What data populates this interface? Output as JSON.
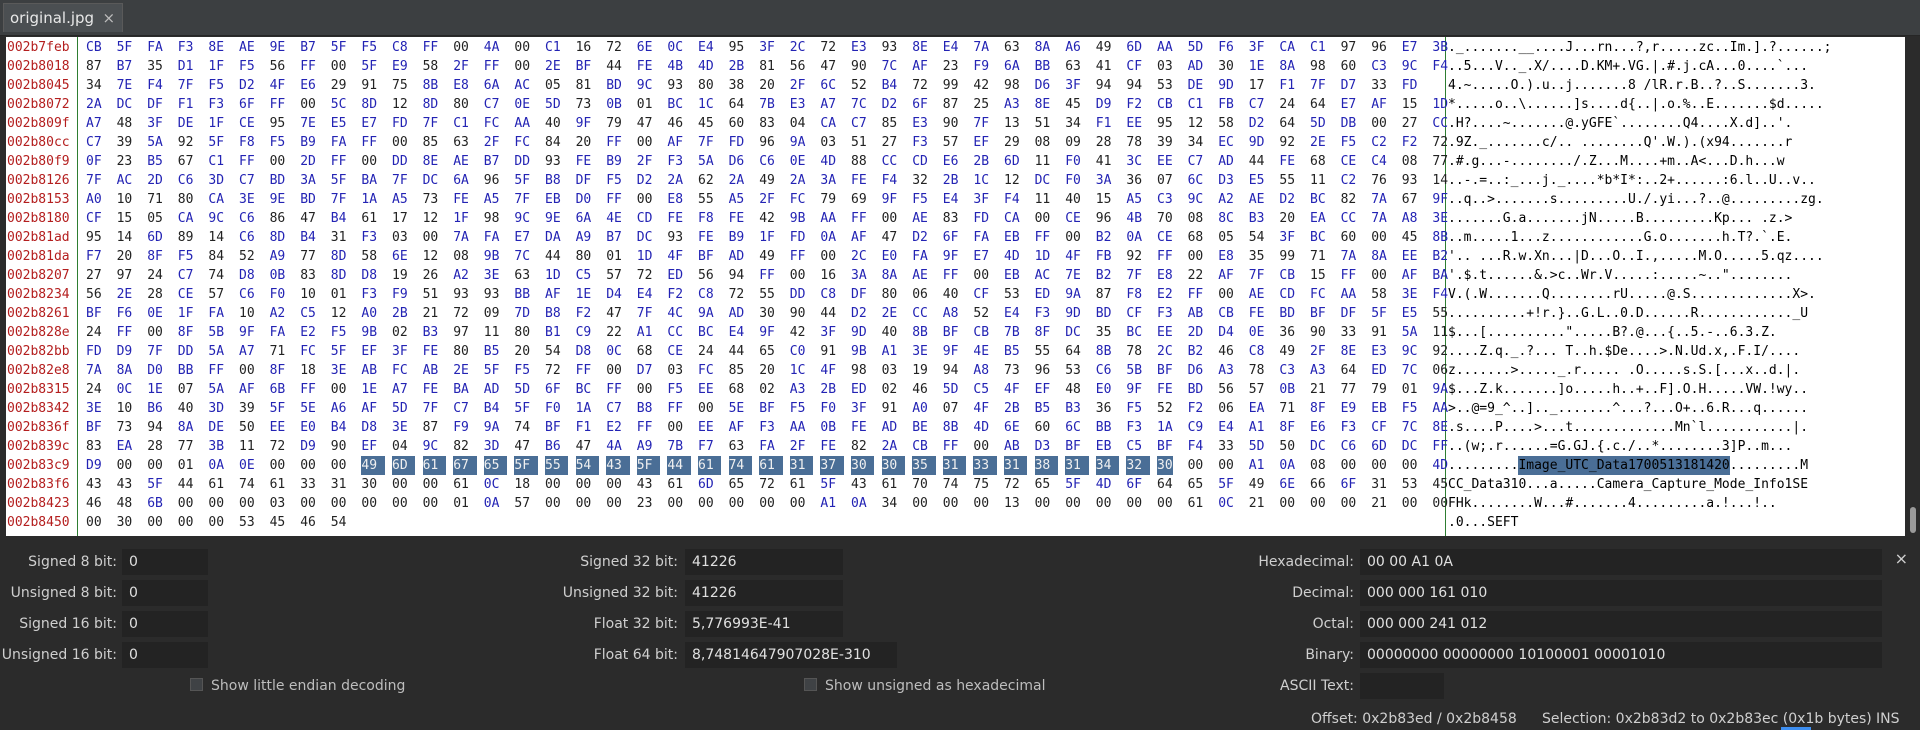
{
  "tab": {
    "title": "original.jpg",
    "close": "×"
  },
  "hex": {
    "rows": [
      {
        "offset": "002b7feb",
        "hex": "CB 5F FA F3 8E AE 9E B7 5F F5 C8 FF 00 4A 00 C1 16 72 6E 0C E4 95 3F 2C 72 E3 93 8E E4 7A 63 8A A6 49 6D AA 5D F6 3F CA C1 97 96 E7 3B",
        "ascii": "._.......__....J...rn...?,r.....zc..Im.].?......;"
      },
      {
        "offset": "002b8018",
        "hex": "87 B7 35 D1 1F F5 56 FF 00 5F E9 58 2F FF 00 2E BF 44 FE 4B 4D 2B 81 56 47 90 7C AF 23 F9 6A BB 63 41 CF 03 AD 30 1E 8A 98 60 C3 9C F4",
        "ascii": "..5...V.._.X/....D.KM+.VG.|.#.j.cA...0....`..."
      },
      {
        "offset": "002b8045",
        "hex": "34 7E F4 7F F5 D2 4F E6 29 91 75 8B E8 6A AC 05 81 BD 9C 93 80 38 20 2F 6C 52 B4 72 99 42 98 D6 3F 94 94 53 DE 9D 17 F1 7F D7 33 FD",
        "ascii": "4.~.....O.).u..j.......8 /lR.r.B..?..S.......3."
      },
      {
        "offset": "002b8072",
        "hex": "2A DC DF F1 F3 6F FF 00 5C 8D 12 8D 80 C7 0E 5D 73 0B 01 BC 1C 64 7B E3 A7 7C D2 6F 87 25 A3 8E 45 D9 F2 CB C1 FB C7 24 64 E7 AF 15 1D",
        "ascii": "*.....o..\\......]s....d{..|.o.%..E.......$d....."
      },
      {
        "offset": "002b809f",
        "hex": "A7 48 3F DE 1F CE 95 7E E5 E7 FD 7F C1 FC AA 40 9F 79 47 46 45 60 83 04 CA C7 85 E3 90 7F 13 51 34 F1 EE 95 12 58 D2 64 5D DB 00 27 CC",
        "ascii": ".H?....~.......@.yGFE`........Q4....X.d]..'."
      },
      {
        "offset": "002b80cc",
        "hex": "C7 39 5A 92 5F F8 F5 B9 FA FF 00 85 63 2F FC 84 20 FF 00 AF 7F FD 96 9A 03 51 27 F3 57 EF 29 08 09 28 78 39 34 EC 9D 92 2E F5 C2 F2 72",
        "ascii": ".9Z._.......c/.. ........Q'.W.).(x94.......r"
      },
      {
        "offset": "002b80f9",
        "hex": "0F 23 B5 67 C1 FF 00 2D FF 00 DD 8E AE B7 DD 93 FE B9 2F F3 5A D6 C6 0E 4D 88 CC CD E6 2B 6D 11 F0 41 3C EE C7 AD 44 FE 68 CE C4 08 77",
        "ascii": ".#.g...-......../.Z...M....+m..A<...D.h...w"
      },
      {
        "offset": "002b8126",
        "hex": "7F AC 2D C6 3D C7 BD 3A 5F BA 7F DC 6A 96 5F B8 DF F5 D2 2A 62 2A 49 2A 3A FE F4 32 2B 1C 12 DC F0 3A 36 07 6C D3 E5 55 11 C2 76 93 14",
        "ascii": "..-.=..:_...j._....*b*I*:..2+......:6.l..U..v.."
      },
      {
        "offset": "002b8153",
        "hex": "A0 10 71 80 CA 3E 9E BD 7F 1A A5 73 FE A5 7F EB D0 FF 00 E8 55 A5 2F FC 79 69 9F F5 E4 3F F4 11 40 15 A5 C3 9C A2 AE D2 BC 82 7A 67 9F",
        "ascii": "..q..>.......s.........U./.yi...?..@.........zg."
      },
      {
        "offset": "002b8180",
        "hex": "CF 15 05 CA 9C C6 86 47 B4 61 17 12 1F 98 9C 9E 6A 4E CD FE F8 FE 42 9B AA FF 00 AE 83 FD CA 00 CE 96 4B 70 08 8C B3 20 EA CC 7A A8 3E",
        "ascii": ".......G.a.......jN.....B.........Kp... .z.>"
      },
      {
        "offset": "002b81ad",
        "hex": "95 14 6D 89 14 C6 8D B4 31 F3 03 00 7A FA E7 DA A9 B7 DC 93 FE B9 1F FD 0A AF 47 D2 6F FA EB FF 00 B2 0A CE 68 05 54 3F BC 60 00 45 8B",
        "ascii": "..m.....1...z............G.o.......h.T?.`.E."
      },
      {
        "offset": "002b81da",
        "hex": "F7 20 8F F5 84 52 A9 77 8D 58 6E 12 08 9B 7C 44 80 01 1D 4F BF AD 49 FF 00 2C E0 FA 9F E7 4D 1D 4F FB 92 FF 00 E8 35 99 71 7A 8A EE B2",
        "ascii": "'.. ...R.w.Xn...|D...O..I.,.....M.O.....5.qz...."
      },
      {
        "offset": "002b8207",
        "hex": "27 97 24 C7 74 D8 0B 83 8D D8 19 26 A2 3E 63 1D C5 57 72 ED 56 94 FF 00 16 3A 8A AE FF 00 EB AC 7E B2 7F E8 22 AF 7F CB 15 FF 00 AF BA",
        "ascii": "'.$.t......&.>c..Wr.V.....:.....~..\"........"
      },
      {
        "offset": "002b8234",
        "hex": "56 2E 28 CE 57 C6 F0 10 01 F3 F9 51 93 93 BB AF 1E D4 E4 F2 C8 72 55 DD C8 DF 80 06 40 CF 53 ED 9A 87 F8 E2 FF 00 AE CD FC AA 58 3E F4",
        "ascii": "V.(.W.......Q........rU.....@.S.............X>."
      },
      {
        "offset": "002b8261",
        "hex": "BF F6 0E 1F FA 10 A2 C5 12 A0 2B 21 72 09 7D B8 F2 47 7F 4C 9A AD 30 90 44 D2 2E CC A8 52 E4 F3 9D BD CF F3 AB CB FE BD BF DF 5F E5 55",
        "ascii": "..........+!r.}..G.L..0.D......R............_U"
      },
      {
        "offset": "002b828e",
        "hex": "24 FF 00 8F 5B 9F FA E2 F5 9B 02 B3 97 11 80 B1 C9 22 A1 CC BC E4 9F 42 3F 9D 40 8B BF CB 7B 8F DC 35 BC EE 2D D4 0E 36 90 33 91 5A 11",
        "ascii": "$...[..........\".....B?.@...{..5.-..6.3.Z."
      },
      {
        "offset": "002b82bb",
        "hex": "FD D9 7F DD 5A A7 71 FC 5F EF 3F FE 80 B5 20 54 D8 0C 68 CE 24 44 65 C0 91 9B A1 3E 9F 4E B5 55 64 8B 78 2C B2 46 C8 49 2F 8E E3 9C 92",
        "ascii": "....Z.q._.?... T..h.$De....>.N.Ud.x,.F.I/...."
      },
      {
        "offset": "002b82e8",
        "hex": "7A 8A D0 BB FF 00 8F 18 3E AB FC AB 2E 5F F5 72 FF 00 D7 03 FC 85 20 1C 4F 98 03 19 94 A8 73 96 53 C6 5B BF D6 A3 78 C3 A3 64 ED 7C 06",
        "ascii": "z.......>....._.r..... .O.....s.S.[...x..d.|."
      },
      {
        "offset": "002b8315",
        "hex": "24 0C 1E 07 5A AF 6B FF 00 1E A7 FE BA AD 5D 6F BC FF 00 F5 EE 68 02 A3 2B ED 02 46 5D C5 4F EF 48 E0 9F FE BD 56 57 0B 21 77 79 01 9A",
        "ascii": "$...Z.k.......]o.....h..+..F].O.H.....VW.!wy.."
      },
      {
        "offset": "002b8342",
        "hex": "3E 10 B6 40 3D 39 5F 5E A6 AF 5D 7F C7 B4 5F F0 1A C7 B8 FF 00 5E BF F5 F0 3F 91 A0 07 4F 2B B5 B3 36 F5 52 F2 06 EA 71 8F E9 EB F5 AA",
        "ascii": ">..@=9_^..].._.......^...?...O+..6.R...q......"
      },
      {
        "offset": "002b836f",
        "hex": "BF 73 94 8A DE 50 EE E0 B4 D8 3E 87 F9 9A 74 BF F1 E2 FF 00 EE AF F3 AA 0B FE AD BE 8B 4D 6E 60 6C BB F3 1A C9 E4 A1 8F E6 F3 CF 7C 8E",
        "ascii": ".s....P....>...t.............Mn`l...........|."
      },
      {
        "offset": "002b839c",
        "hex": "83 EA 28 77 3B 11 72 D9 90 EF 04 9C 82 3D 47 B6 47 4A A9 7B F7 63 FA 2F FE 82 2A CB FF 00 AB D3 BF EB C5 BF F4 33 5D 50 DC C6 6D DC FF",
        "ascii": "..(w;.r......=G.GJ.{.c./..*........3]P..m..."
      },
      {
        "offset": "002b83c9",
        "hex": "D9 00 00 01 0A 0E 00 00 00 49 6D 61 67 65 5F 55 54 43 5F 44 61 74 61 31 37 30 30 35 31 33 31 38 31 34 32 30 00 00 A1 0A 08 00 00 00 4D",
        "ascii": ".........Image_UTC_Data1700513181420.........M"
      },
      {
        "offset": "002b83f6",
        "hex": "43 43 5F 44 61 74 61 33 31 30 00 00 61 0C 18 00 00 00 43 61 6D 65 72 61 5F 43 61 70 74 75 72 65 5F 4D 6F 64 65 5F 49 6E 66 6F 31 53 45",
        "ascii": "CC_Data310...a.....Camera_Capture_Mode_Info1SE"
      },
      {
        "offset": "002b8423",
        "hex": "46 48 6B 00 00 00 03 00 00 00 00 00 01 0A 57 00 00 00 23 00 00 00 00 00 A1 0A 34 00 00 00 13 00 00 00 00 00 61 0C 21 00 00 00 21 00 00",
        "ascii": "FHk........W...#.......4.........a.!...!.."
      },
      {
        "offset": "002b8450",
        "hex": "00 30 00 00 00 53 45 46 54",
        "ascii": ".0...SEFT"
      }
    ]
  },
  "inspector": {
    "signed8": {
      "label": "Signed 8 bit:",
      "value": "0"
    },
    "unsigned8": {
      "label": "Unsigned 8 bit:",
      "value": "0"
    },
    "signed16": {
      "label": "Signed 16 bit:",
      "value": "0"
    },
    "unsigned16": {
      "label": "Unsigned 16 bit:",
      "value": "0"
    },
    "signed32": {
      "label": "Signed 32 bit:",
      "value": "41226"
    },
    "unsigned32": {
      "label": "Unsigned 32 bit:",
      "value": "41226"
    },
    "float32": {
      "label": "Float 32 bit:",
      "value": "5,776993E-41"
    },
    "float64": {
      "label": "Float 64 bit:",
      "value": "8,74814647907028E-310"
    },
    "hexadecimal": {
      "label": "Hexadecimal:",
      "value": "00 00 A1 0A"
    },
    "decimal": {
      "label": "Decimal:",
      "value": "000 000 161 010"
    },
    "octal": {
      "label": "Octal:",
      "value": "000 000 241 012"
    },
    "binary": {
      "label": "Binary:",
      "value": "00000000 00000000 10100001 00001010"
    },
    "ascii": {
      "label": "ASCII Text:",
      "value": ""
    },
    "little_endian": "Show little endian decoding",
    "unsigned_hex": "Show unsigned as hexadecimal",
    "close": "×"
  },
  "status": {
    "offset": "Offset: 0x2b83ed / 0x2b8458",
    "selection": "Selection: 0x2b83d2 to 0x2b83ec (0x1b bytes)",
    "mode": "INS"
  }
}
